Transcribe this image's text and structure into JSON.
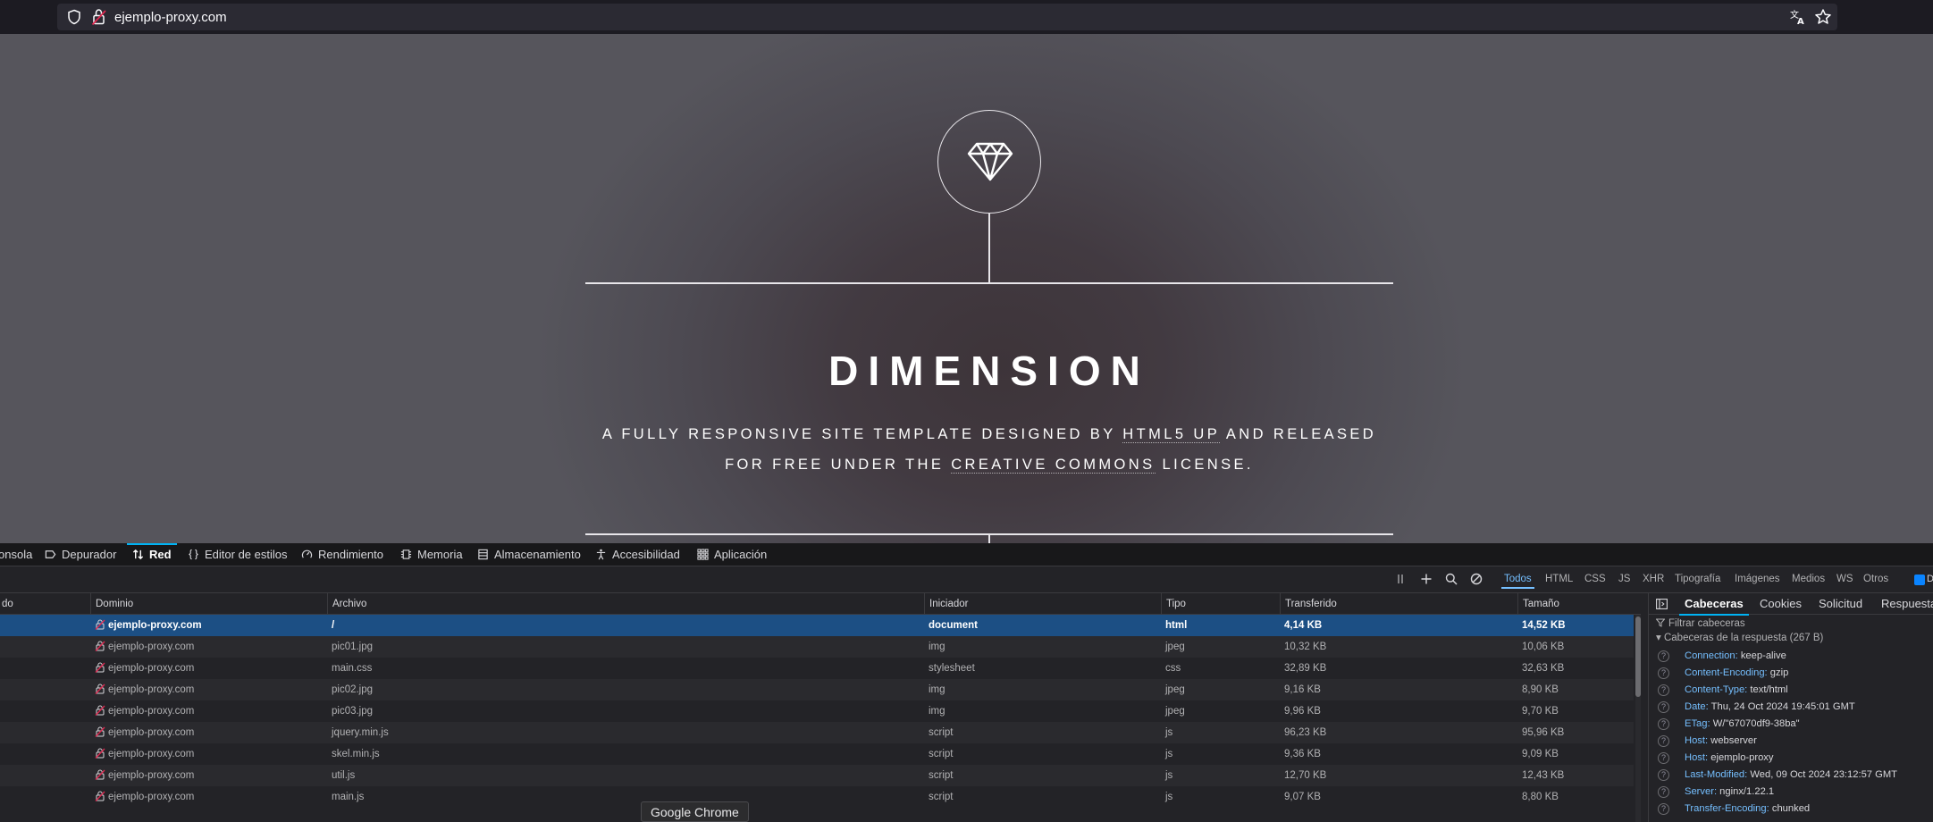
{
  "browser": {
    "url": "ejemplo-proxy.com"
  },
  "site": {
    "title": "DIMENSION",
    "tagline_line1_pre": "A FULLY RESPONSIVE SITE TEMPLATE DESIGNED BY ",
    "tagline_link1": "HTML5 UP",
    "tagline_line1_post": " AND RELEASED",
    "tagline_line2_pre": "FOR FREE UNDER THE ",
    "tagline_link2": "CREATIVE COMMONS",
    "tagline_line2_post": " LICENSE."
  },
  "devtools": {
    "tabs": [
      {
        "label": "onsola",
        "icon": "console-icon"
      },
      {
        "label": "Depurador",
        "icon": "debugger-icon"
      },
      {
        "label": "Red",
        "icon": "network-icon",
        "active": true
      },
      {
        "label": "Editor de estilos",
        "icon": "braces-icon"
      },
      {
        "label": "Rendimiento",
        "icon": "gauge-icon"
      },
      {
        "label": "Memoria",
        "icon": "chip-icon"
      },
      {
        "label": "Almacenamiento",
        "icon": "storage-icon"
      },
      {
        "label": "Accesibilidad",
        "icon": "accessibility-icon"
      },
      {
        "label": "Aplicación",
        "icon": "grid-icon"
      }
    ],
    "filters": [
      "Todos",
      "HTML",
      "CSS",
      "JS",
      "XHR",
      "Tipografía",
      "Imágenes",
      "Medios",
      "WS",
      "Otros"
    ],
    "active_filter": "Todos",
    "checkbox_label": "D",
    "columns": {
      "status": "do",
      "domain": "Dominio",
      "file": "Archivo",
      "initiator": "Iniciador",
      "type": "Tipo",
      "transferred": "Transferido",
      "size": "Tamaño"
    },
    "rows": [
      {
        "domain": "ejemplo-proxy.com",
        "file": "/",
        "initiator": "document",
        "type": "html",
        "transferred": "4,14 KB",
        "size": "14,52 KB"
      },
      {
        "domain": "ejemplo-proxy.com",
        "file": "pic01.jpg",
        "initiator": "img",
        "type": "jpeg",
        "transferred": "10,32 KB",
        "size": "10,06 KB"
      },
      {
        "domain": "ejemplo-proxy.com",
        "file": "main.css",
        "initiator": "stylesheet",
        "type": "css",
        "transferred": "32,89 KB",
        "size": "32,63 KB"
      },
      {
        "domain": "ejemplo-proxy.com",
        "file": "pic02.jpg",
        "initiator": "img",
        "type": "jpeg",
        "transferred": "9,16 KB",
        "size": "8,90 KB"
      },
      {
        "domain": "ejemplo-proxy.com",
        "file": "pic03.jpg",
        "initiator": "img",
        "type": "jpeg",
        "transferred": "9,96 KB",
        "size": "9,70 KB"
      },
      {
        "domain": "ejemplo-proxy.com",
        "file": "jquery.min.js",
        "initiator": "script",
        "type": "js",
        "transferred": "96,23 KB",
        "size": "95,96 KB"
      },
      {
        "domain": "ejemplo-proxy.com",
        "file": "skel.min.js",
        "initiator": "script",
        "type": "js",
        "transferred": "9,36 KB",
        "size": "9,09 KB"
      },
      {
        "domain": "ejemplo-proxy.com",
        "file": "util.js",
        "initiator": "script",
        "type": "js",
        "transferred": "12,70 KB",
        "size": "12,43 KB"
      },
      {
        "domain": "ejemplo-proxy.com",
        "file": "main.js",
        "initiator": "script",
        "type": "js",
        "transferred": "9,07 KB",
        "size": "8,80 KB"
      }
    ],
    "side_tabs": [
      "Cabeceras",
      "Cookies",
      "Solicitud",
      "Respuesta"
    ],
    "filter_headers_placeholder": "Filtrar cabeceras",
    "response_section": "Cabeceras de la respuesta (267 B)",
    "response_headers": [
      {
        "name": "Connection:",
        "value": "keep-alive"
      },
      {
        "name": "Content-Encoding:",
        "value": "gzip"
      },
      {
        "name": "Content-Type:",
        "value": "text/html"
      },
      {
        "name": "Date:",
        "value": "Thu, 24 Oct 2024 19:45:01 GMT"
      },
      {
        "name": "ETag:",
        "value": "W/\"67070df9-38ba\""
      },
      {
        "name": "Host:",
        "value": "webserver"
      },
      {
        "name": "Host:",
        "value": "ejemplo-proxy"
      },
      {
        "name": "Last-Modified:",
        "value": "Wed, 09 Oct 2024 23:12:57 GMT"
      },
      {
        "name": "Server:",
        "value": "nginx/1.22.1"
      },
      {
        "name": "Transfer-Encoding:",
        "value": "chunked"
      }
    ]
  },
  "tooltip": "Google Chrome",
  "colors": {
    "accent": "#00b3f4",
    "selected_row": "#1c4f84",
    "header_key": "#75bfff"
  }
}
